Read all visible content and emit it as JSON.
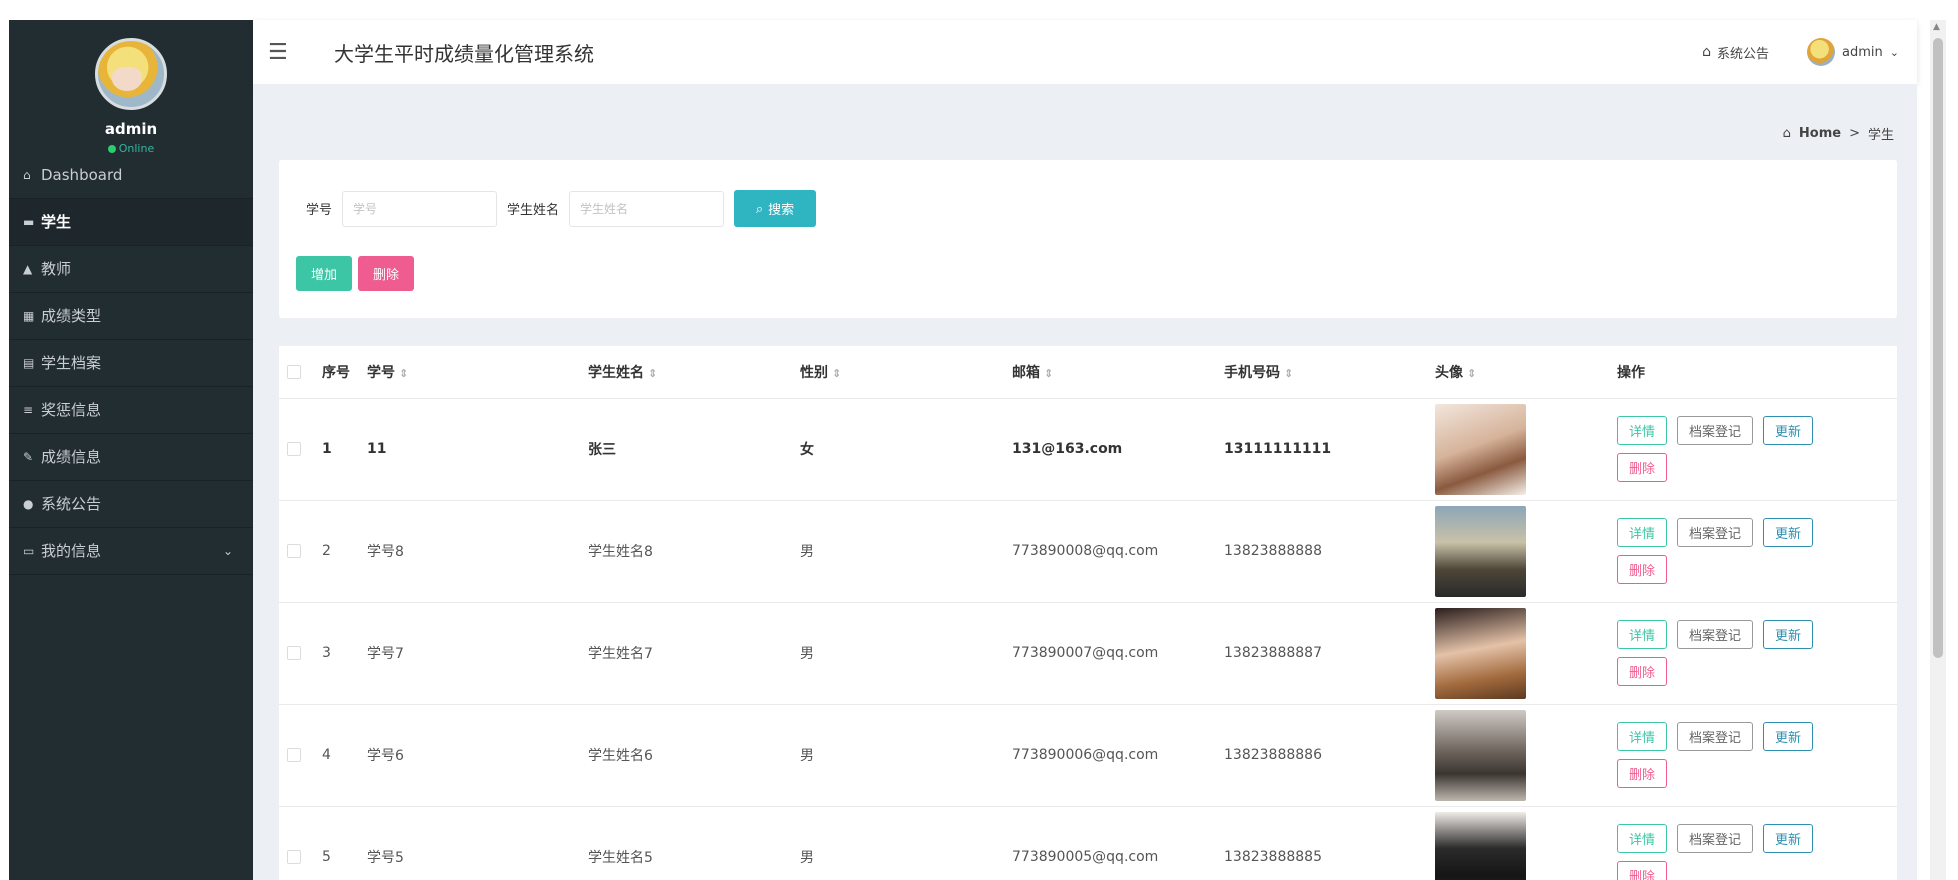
{
  "app": {
    "title": "大学生平时成绩量化管理系统"
  },
  "topbar": {
    "notice_label": "系统公告",
    "user_label": "admin"
  },
  "profile": {
    "name": "admin",
    "status": "Online"
  },
  "sidebar": {
    "items": [
      {
        "label": "Dashboard",
        "icon": "home-icon"
      },
      {
        "label": "学生",
        "icon": "id-card-icon"
      },
      {
        "label": "教师",
        "icon": "user-icon"
      },
      {
        "label": "成绩类型",
        "icon": "grid-icon"
      },
      {
        "label": "学生档案",
        "icon": "table-icon"
      },
      {
        "label": "奖惩信息",
        "icon": "list-icon"
      },
      {
        "label": "成绩信息",
        "icon": "edit-icon"
      },
      {
        "label": "系统公告",
        "icon": "pin-icon"
      },
      {
        "label": "我的信息",
        "icon": "card-icon"
      }
    ]
  },
  "breadcrumb": {
    "home": "Home",
    "separator": ">",
    "current": "学生"
  },
  "search": {
    "id_label": "学号",
    "id_placeholder": "学号",
    "name_label": "学生姓名",
    "name_placeholder": "学生姓名",
    "button": "搜索"
  },
  "actions": {
    "add": "增加",
    "delete": "删除"
  },
  "table": {
    "headers": {
      "index": "序号",
      "student_id": "学号",
      "name": "学生姓名",
      "gender": "性别",
      "email": "邮箱",
      "phone": "手机号码",
      "avatar": "头像",
      "ops": "操作"
    },
    "op_labels": {
      "detail": "详情",
      "archive": "档案登记",
      "update": "更新",
      "delete": "删除"
    },
    "rows": [
      {
        "index": "1",
        "student_id": "11",
        "name": "张三",
        "gender": "女",
        "email": "131@163.com",
        "phone": "13111111111"
      },
      {
        "index": "2",
        "student_id": "学号8",
        "name": "学生姓名8",
        "gender": "男",
        "email": "773890008@qq.com",
        "phone": "13823888888"
      },
      {
        "index": "3",
        "student_id": "学号7",
        "name": "学生姓名7",
        "gender": "男",
        "email": "773890007@qq.com",
        "phone": "13823888887"
      },
      {
        "index": "4",
        "student_id": "学号6",
        "name": "学生姓名6",
        "gender": "男",
        "email": "773890006@qq.com",
        "phone": "13823888886"
      },
      {
        "index": "5",
        "student_id": "学号5",
        "name": "学生姓名5",
        "gender": "男",
        "email": "773890005@qq.com",
        "phone": "13823888885"
      }
    ]
  }
}
